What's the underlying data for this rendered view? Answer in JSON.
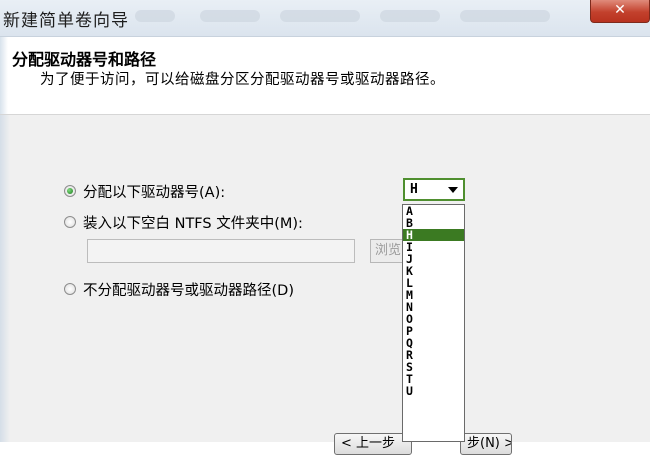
{
  "window": {
    "title": "新建简单卷向导",
    "close_label": "✕"
  },
  "header": {
    "title": "分配驱动器号和路径",
    "subtitle": "为了便于访问，可以给磁盘分区分配驱动器号或驱动器路径。"
  },
  "options": {
    "assign_letter": {
      "label": "分配以下驱动器号(A):",
      "selected": true
    },
    "mount_folder": {
      "label": "装入以下空白 NTFS 文件夹中(M):",
      "selected": false
    },
    "no_assign": {
      "label": "不分配驱动器号或驱动器路径(D)",
      "selected": false
    }
  },
  "path_input": {
    "value": ""
  },
  "browse_button": {
    "label": "浏览"
  },
  "drive_combo": {
    "selected": "H",
    "options": [
      "A",
      "B",
      "H",
      "I",
      "J",
      "K",
      "L",
      "M",
      "N",
      "O",
      "P",
      "Q",
      "R",
      "S",
      "T",
      "U"
    ]
  },
  "footer": {
    "back_label": "< 上一步",
    "next_label": "步(N) >"
  }
}
